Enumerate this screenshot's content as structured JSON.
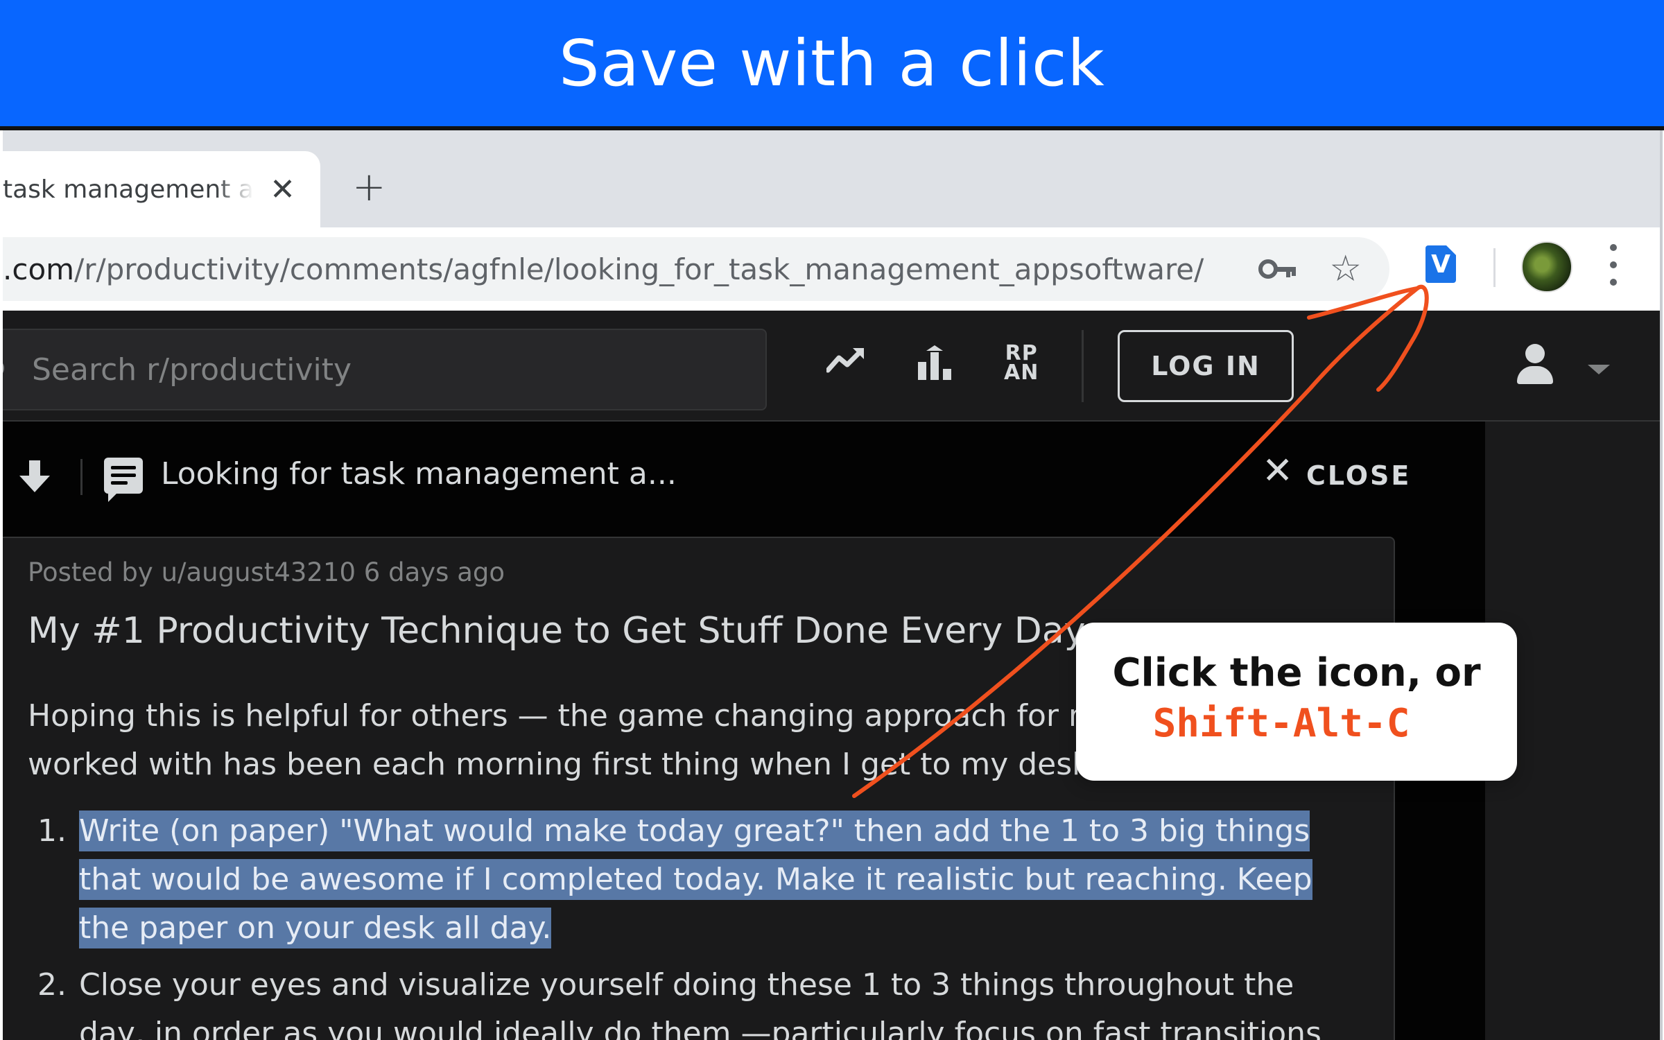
{
  "banner": {
    "title": "Save with a click"
  },
  "browser": {
    "tab": {
      "title": "task management app"
    },
    "url": {
      "host": ".com",
      "path": "/r/productivity/comments/agfnle/looking_for_task_management_appsoftware/"
    },
    "extension": {
      "glyph": "V"
    }
  },
  "reddit": {
    "search": {
      "placeholder": "Search r/productivity"
    },
    "rpan": {
      "line1": "RP",
      "line2": "AN"
    },
    "login_label": "LOG IN",
    "postbar": {
      "title": "Looking for task management a...",
      "close_label": "CLOSE"
    },
    "post": {
      "meta": "Posted by u/august43210 6 days ago",
      "title": "My #1 Productivity Technique to Get Stuff Done Every Day",
      "body": "Hoping this is helpful for others — the game changing approach for me that I've worked with has been each morning first thing when I get to my desk:",
      "list": [
        {
          "num": "1.",
          "text": "Write (on paper) \"What would make today great?\" then add the 1 to 3 big things that would be awesome if I completed today. Make it realistic but reaching. Keep the paper on your desk all day."
        },
        {
          "num": "2.",
          "text": "Close your eyes and visualize yourself doing these 1 to 3 things throughout the day, in order as you would ideally do them —particularly focus on fast transitions"
        }
      ]
    }
  },
  "callout": {
    "line1": "Click the icon, or",
    "line2": "Shift-Alt-C"
  },
  "colors": {
    "banner": "#0866ff",
    "accent": "#f0501e",
    "highlight": "#5878a6"
  }
}
